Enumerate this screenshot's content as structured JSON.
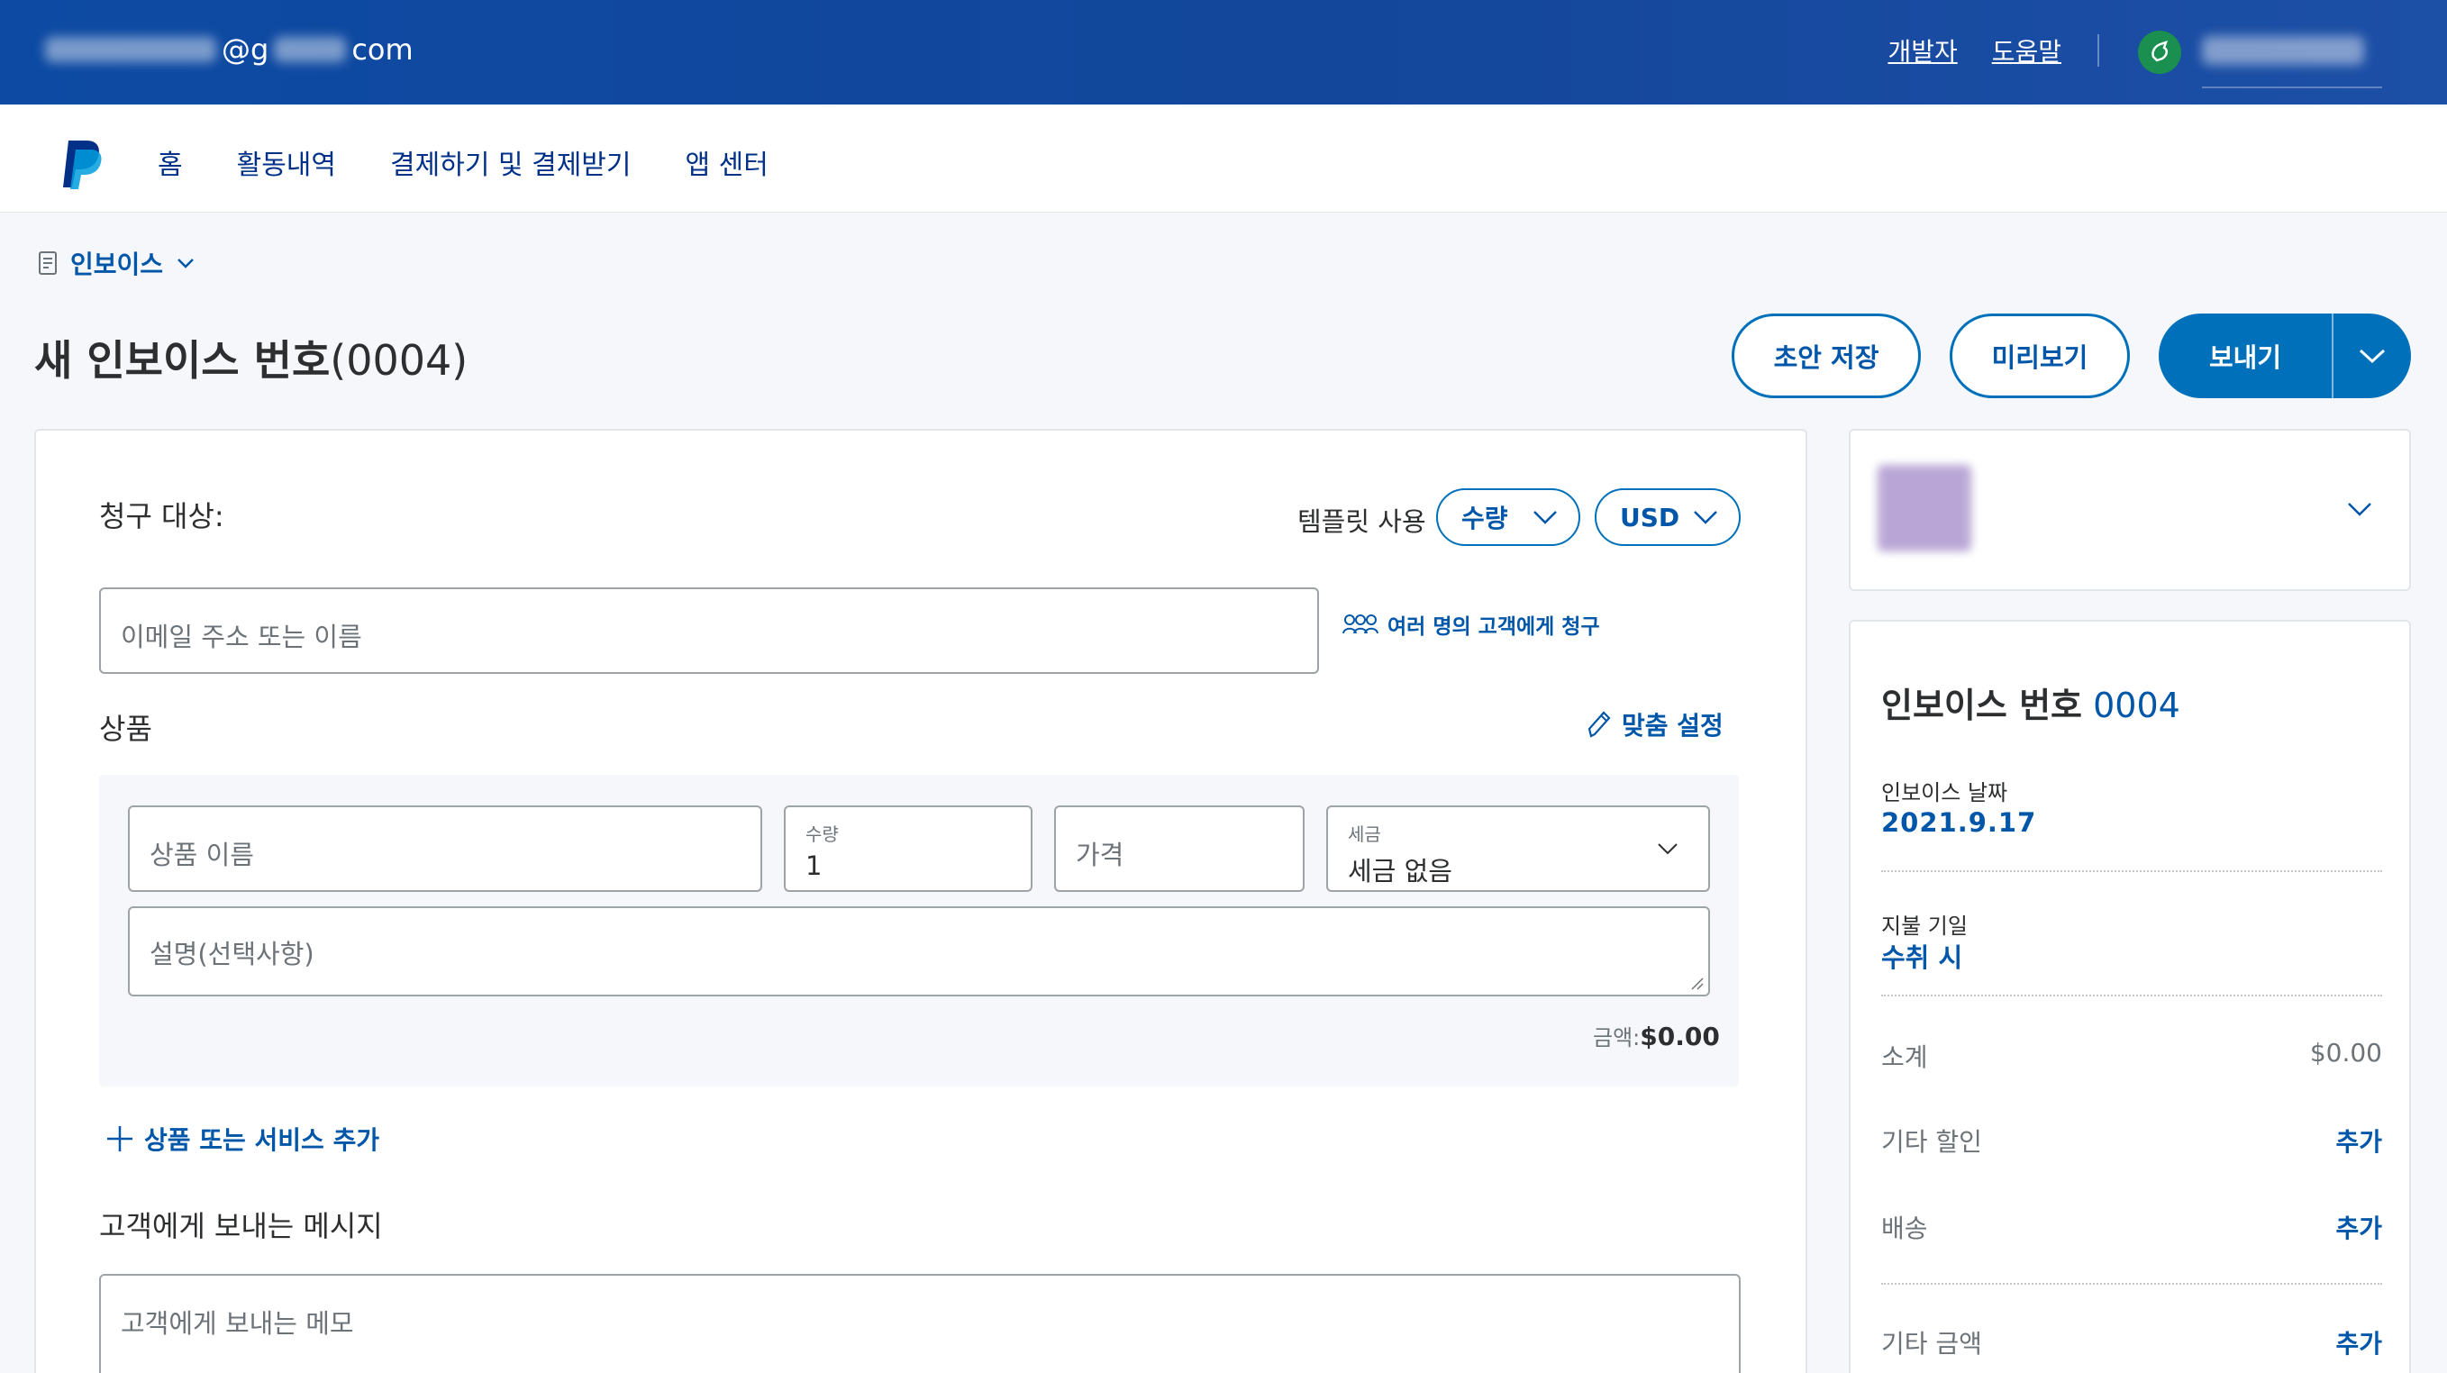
{
  "topbar": {
    "email_at": "@g",
    "email_domain": "com",
    "links": [
      "개발자",
      "도움말"
    ]
  },
  "nav": {
    "items": [
      "홈",
      "활동내역",
      "결제하기 및 결제받기",
      "앱 센터"
    ]
  },
  "breadcrumb": {
    "label": "인보이스"
  },
  "header": {
    "title_bold": "새 인보이스 번호",
    "title_number": "(0004)",
    "draft_button": "초안 저장",
    "preview_button": "미리보기",
    "send_button": "보내기"
  },
  "bill_to": {
    "label": "청구 대상:",
    "template_label": "템플릿 사용",
    "template_value": "수량",
    "currency_value": "USD",
    "recipient_placeholder": "이메일 주소 또는 이름",
    "multi_link": "여러 명의 고객에게 청구"
  },
  "items": {
    "label": "상품",
    "customize_link": "맞춤 설정",
    "name_placeholder": "상품 이름",
    "qty_label": "수량",
    "qty_value": "1",
    "price_placeholder": "가격",
    "tax_label": "세금",
    "tax_value": "세금 없음",
    "description_placeholder": "설명(선택사항)",
    "amount_label": "금액:",
    "amount_value": "$0.00",
    "add_link": "상품 또는 서비스 추가"
  },
  "message": {
    "label": "고객에게 보내는 메시지",
    "placeholder": "고객에게 보내는 메모"
  },
  "summary": {
    "invoice_label": "인보이스 번호",
    "invoice_number": "0004",
    "date_label": "인보이스 날짜",
    "date_value": "2021.9.17",
    "due_label": "지불 기일",
    "due_value": "수취 시",
    "subtotal_label": "소계",
    "subtotal_value": "$0.00",
    "discount_label": "기타 할인",
    "discount_action": "추가",
    "shipping_label": "배송",
    "shipping_action": "추가",
    "other_label": "기타 금액",
    "other_action": "추가"
  },
  "colors": {
    "brand_blue": "#0070ba",
    "link_blue": "#0056a8",
    "topbar": "#13479b"
  }
}
